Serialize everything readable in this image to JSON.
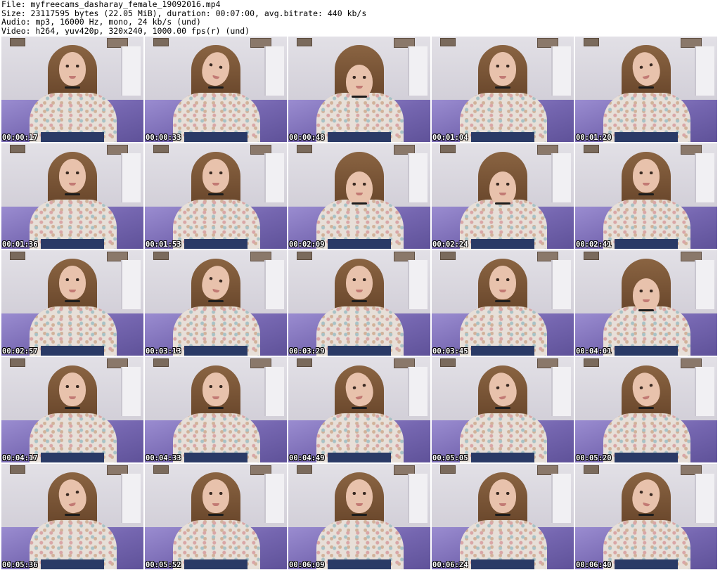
{
  "header": {
    "file_line": "File: myfreecams_dasharay_female_19092016.mp4",
    "size_line": "Size: 23117595 bytes (22.05 MiB), duration: 00:07:00, avg.bitrate: 440 kb/s",
    "audio_line": "Audio: mp3, 16000 Hz, mono, 24 kb/s (und)",
    "video_line": "Video: h264, yuv420p, 320x240, 1000.00 fps(r) (und)"
  },
  "thumbnails": [
    {
      "timestamp": "00:00:17"
    },
    {
      "timestamp": "00:00:33"
    },
    {
      "timestamp": "00:00:48"
    },
    {
      "timestamp": "00:01:04"
    },
    {
      "timestamp": "00:01:20"
    },
    {
      "timestamp": "00:01:36"
    },
    {
      "timestamp": "00:01:53"
    },
    {
      "timestamp": "00:02:09"
    },
    {
      "timestamp": "00:02:24"
    },
    {
      "timestamp": "00:02:41"
    },
    {
      "timestamp": "00:02:57"
    },
    {
      "timestamp": "00:03:13"
    },
    {
      "timestamp": "00:03:29"
    },
    {
      "timestamp": "00:03:45"
    },
    {
      "timestamp": "00:04:01"
    },
    {
      "timestamp": "00:04:17"
    },
    {
      "timestamp": "00:04:33"
    },
    {
      "timestamp": "00:04:49"
    },
    {
      "timestamp": "00:05:05"
    },
    {
      "timestamp": "00:05:20"
    },
    {
      "timestamp": "00:05:36"
    },
    {
      "timestamp": "00:05:52"
    },
    {
      "timestamp": "00:06:09"
    },
    {
      "timestamp": "00:06:24"
    },
    {
      "timestamp": "00:06:40"
    }
  ]
}
